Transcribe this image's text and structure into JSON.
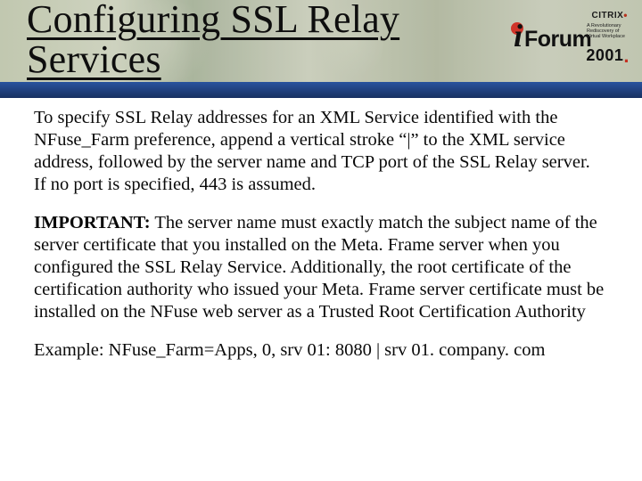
{
  "title": "Configuring SSL Relay Services",
  "logo": {
    "citrix_text": "CITRIX",
    "iforum_i": "i",
    "iforum_text": "Forum",
    "subline": "A Revolutionary Rediscovery of Virtual Workplace",
    "year_main": "2001",
    "year_dot": "."
  },
  "paragraphs": {
    "p1": "To specify SSL Relay addresses for an XML Service identified with the NFuse_Farm preference, append a vertical stroke “|” to the XML service address, followed by the server name and TCP port of the SSL Relay server.  If no port is specified, 443 is assumed.",
    "p2_label": "IMPORTANT:",
    "p2_body": "  The server name must exactly match the subject name of the server certificate that you installed on the Meta. Frame server when you configured the SSL Relay Service. Additionally, the root certificate of the certification authority who issued your Meta. Frame server certificate must be installed on the NFuse web server as a Trusted Root Certification Authority",
    "p3": "Example: NFuse_Farm=Apps, 0, srv 01: 8080 | srv 01. company. com"
  }
}
